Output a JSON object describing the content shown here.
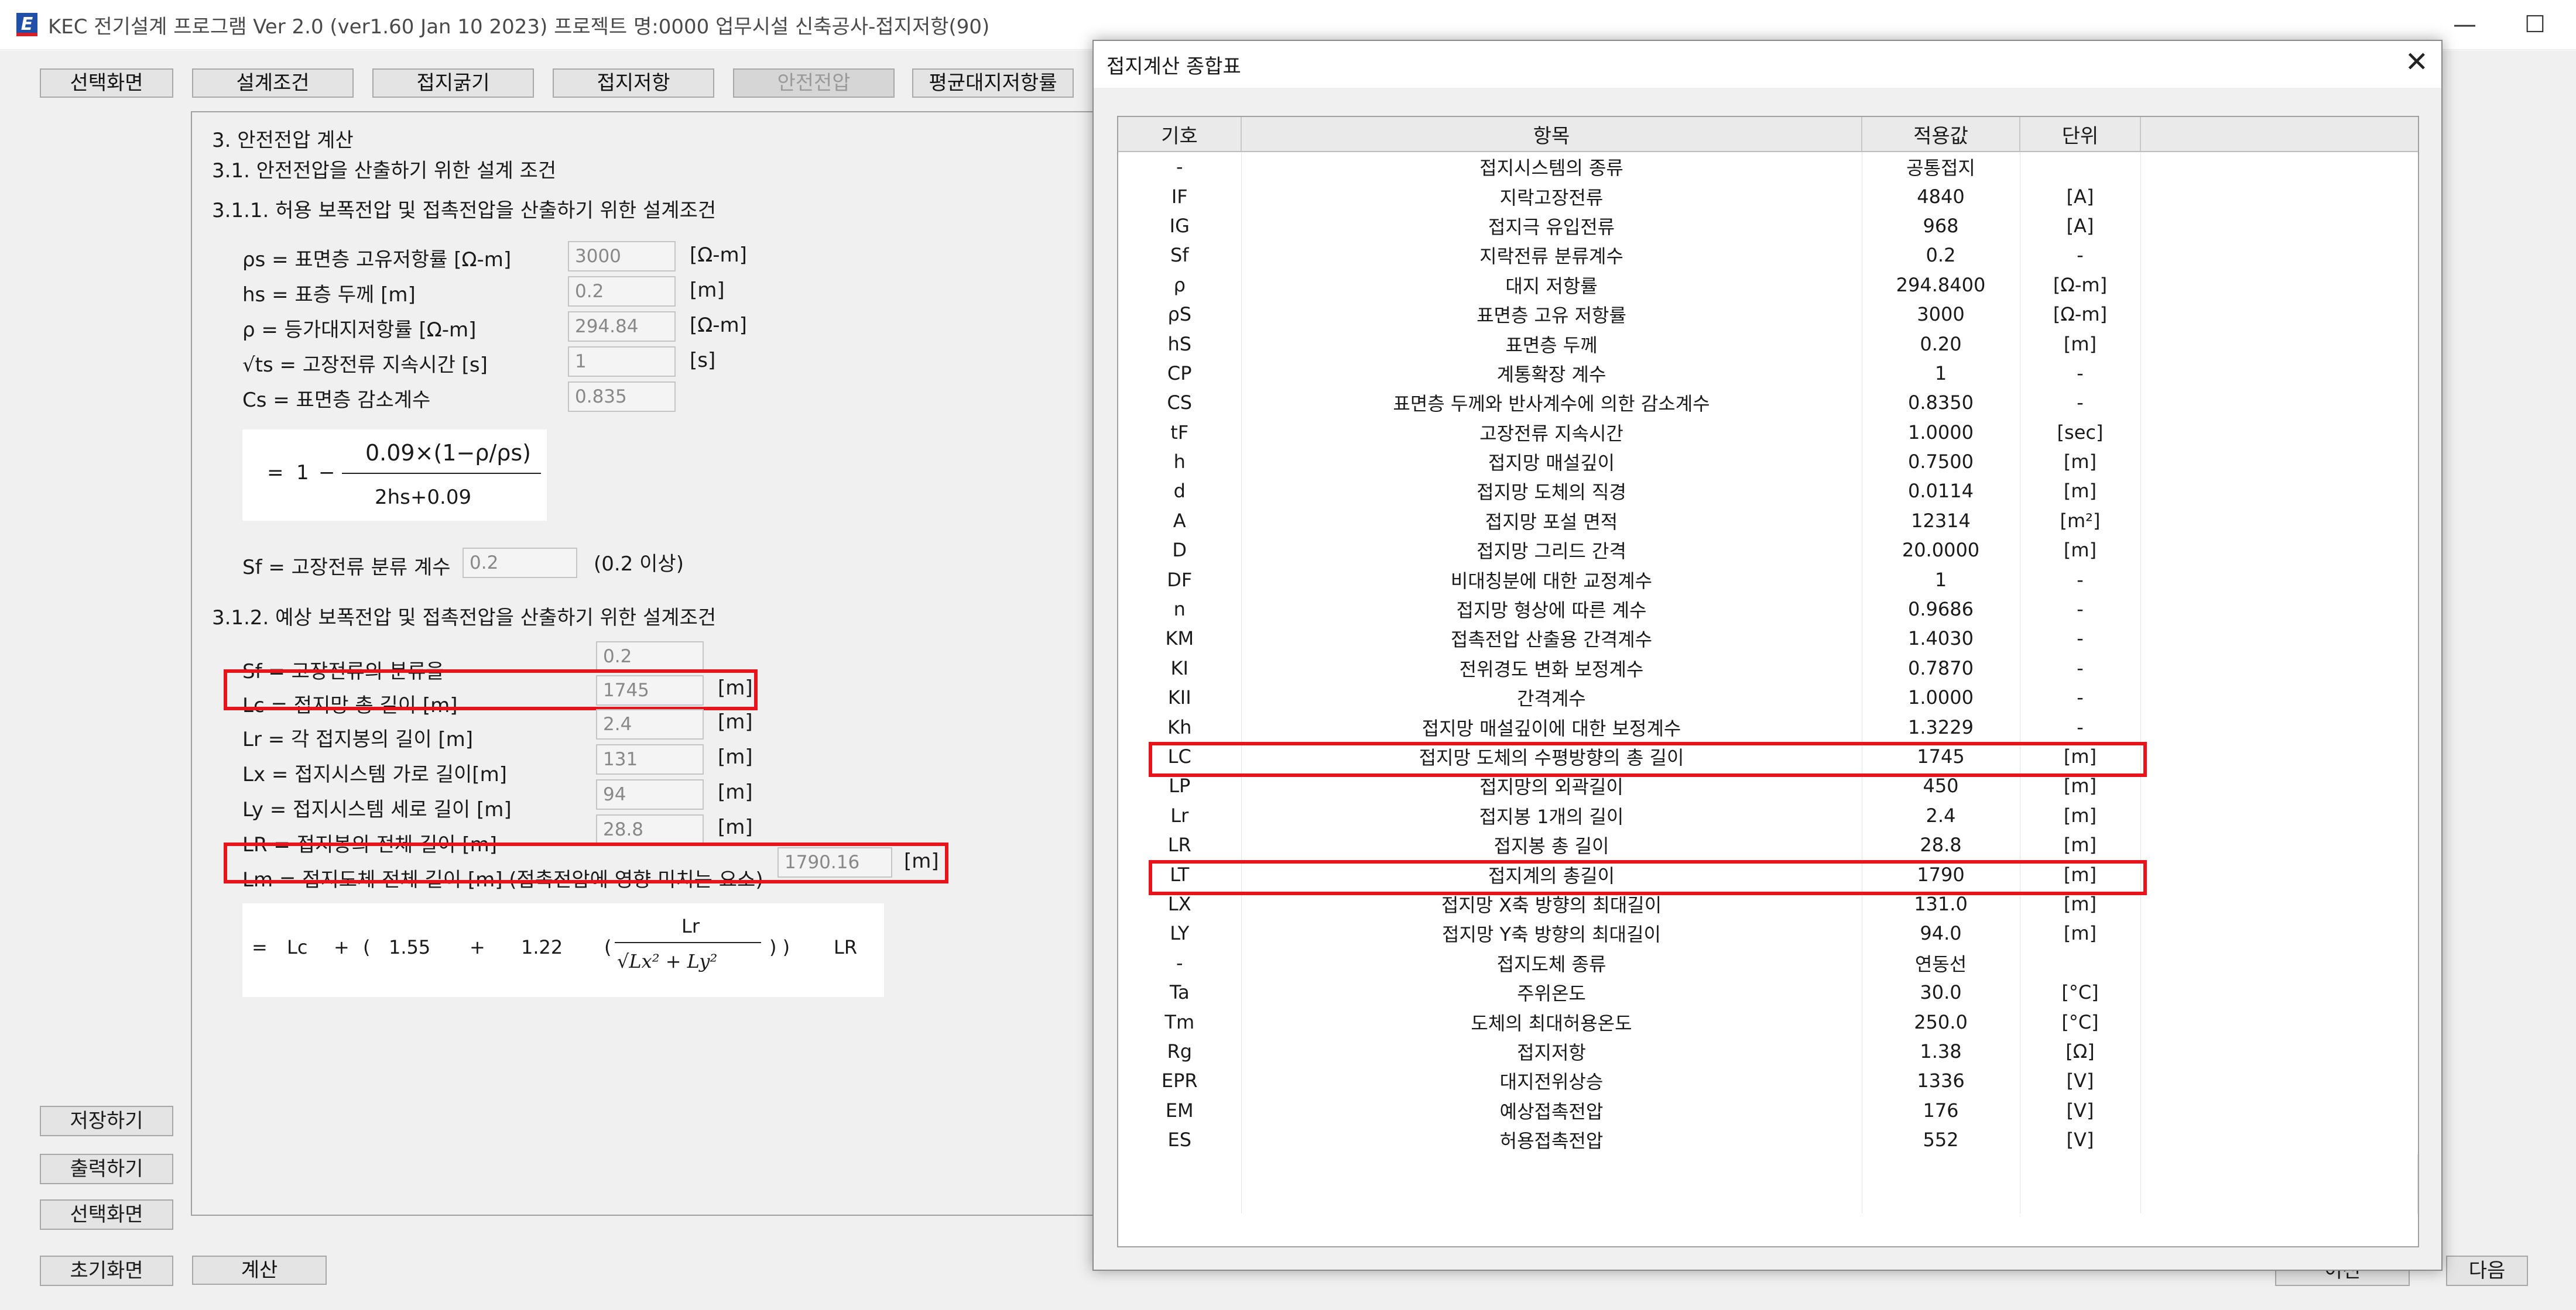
{
  "window": {
    "title": "KEC 전기설계 프로그램 Ver 2.0 (ver1.60 Jan 10 2023) 프로젝트 명:0000 업무시설 신축공사-접지저항(90)",
    "icon_letter": "E",
    "min_symbol": "—",
    "max_symbol": "☐"
  },
  "tabs": [
    "선택화면",
    "설계조건",
    "접지굵기",
    "접지저항",
    "안전전압",
    "평균대지저항률"
  ],
  "content": {
    "h1": "3. 안전전압 계산",
    "h2": "3.1. 안전전압을 산출하기 위한 설계 조건",
    "h3": "3.1.1. 허용 보폭전압 및 접촉전압을 산출하기 위한 설계조건",
    "params1": [
      {
        "label": "ρs = 표면층 고유저항률 [Ω-m]",
        "value": "3000",
        "unit": "[Ω-m]"
      },
      {
        "label": "hs = 표층 두께 [m]",
        "value": "0.2",
        "unit": "[m]"
      },
      {
        "label": "ρ = 등가대지저항률 [Ω-m]",
        "value": "294.84",
        "unit": "[Ω-m]"
      },
      {
        "label": "√ts = 고장전류 지속시간 [s]",
        "value": "1",
        "unit": "[s]"
      },
      {
        "label": "Cs = 표면층 감소계수",
        "value": "0.835",
        "unit": ""
      }
    ],
    "formula1": {
      "eq": "=",
      "one": "1",
      "minus": "−",
      "numerator": "0.09×(1−ρ/ρs)",
      "denominator": "2hs+0.09"
    },
    "sf_label": "Sf = 고장전류 분류 계수",
    "sf_value": "0.2",
    "sf_note": "(0.2 이상)",
    "h4": "3.1.2. 예상 보폭전압 및 접촉전압을 산출하기 위한 설계조건",
    "params2": [
      {
        "label": "Sf = 고장전류의 분류율",
        "value": "0.2",
        "unit": ""
      },
      {
        "label": "Lc = 접지망 총 길이 [m]",
        "value": "1745",
        "unit": "[m]"
      },
      {
        "label": "Lr = 각 접지봉의 길이 [m]",
        "value": "2.4",
        "unit": "[m]"
      },
      {
        "label": "Lx = 접지시스템 가로 길이[m]",
        "value": "131",
        "unit": "[m]"
      },
      {
        "label": "Ly = 접지시스템 세로 길이 [m]",
        "value": "94",
        "unit": "[m]"
      },
      {
        "label": "LR = 접지봉의 전체 길이 [m]",
        "value": "28.8",
        "unit": "[m]"
      }
    ],
    "lm_label": "Lm = 접지도체 전체 길이 [m] (접촉전압에 영향 미치는 요소)",
    "lm_value": "1790.16",
    "lm_unit": "[m]",
    "formula2": {
      "eq": "=",
      "lc": "Lc",
      "plus": "+",
      "lparen": "(",
      "a": "1.55",
      "plus2": "+",
      "b": "1.22",
      "lparen2": "(",
      "num": "Lr",
      "den": "√Lx² + Ly²",
      "rparen": ") )",
      "lr": "LR"
    }
  },
  "side_buttons": [
    "저장하기",
    "출력하기",
    "선택화면"
  ],
  "bottom_buttons": {
    "reset": "초기화면",
    "calc": "계산",
    "prev": "이전",
    "next": "다음"
  },
  "dialog": {
    "title": "접지계산 종합표",
    "close": "✕",
    "headers": [
      "기호",
      "항목",
      "적용값",
      "단위"
    ],
    "rows": [
      [
        "-",
        "접지시스템의 종류",
        "공통접지",
        ""
      ],
      [
        "IF",
        "지락고장전류",
        "4840",
        "[A]"
      ],
      [
        "IG",
        "접지극 유입전류",
        "968",
        "[A]"
      ],
      [
        "Sf",
        "지락전류 분류계수",
        "0.2",
        "-"
      ],
      [
        "ρ",
        "대지 저항률",
        "294.8400",
        "[Ω-m]"
      ],
      [
        "ρS",
        "표면층 고유 저항률",
        "3000",
        "[Ω-m]"
      ],
      [
        "hS",
        "표면층 두께",
        "0.20",
        "[m]"
      ],
      [
        "CP",
        "계통확장 계수",
        "1",
        "-"
      ],
      [
        "CS",
        "표면층 두께와 반사계수에 의한 감소계수",
        "0.8350",
        "-"
      ],
      [
        "tF",
        "고장전류 지속시간",
        "1.0000",
        "[sec]"
      ],
      [
        "h",
        "접지망 매설깊이",
        "0.7500",
        "[m]"
      ],
      [
        "d",
        "접지망 도체의 직경",
        "0.0114",
        "[m]"
      ],
      [
        "A",
        "접지망 포설 면적",
        "12314",
        "[m²]"
      ],
      [
        "D",
        "접지망 그리드 간격",
        "20.0000",
        "[m]"
      ],
      [
        "DF",
        "비대칭분에 대한 교정계수",
        "1",
        "-"
      ],
      [
        "n",
        "접지망 형상에 따른 계수",
        "0.9686",
        "-"
      ],
      [
        "KM",
        "접촉전압 산출용 간격계수",
        "1.4030",
        "-"
      ],
      [
        "KI",
        "전위경도 변화 보정계수",
        "0.7870",
        "-"
      ],
      [
        "KII",
        "간격계수",
        "1.0000",
        "-"
      ],
      [
        "Kh",
        "접지망 매설깊이에 대한 보정계수",
        "1.3229",
        "-"
      ],
      [
        "LC",
        "접지망 도체의 수평방향의 총 길이",
        "1745",
        "[m]"
      ],
      [
        "LP",
        "접지망의 외곽길이",
        "450",
        "[m]"
      ],
      [
        "Lr",
        "접지봉 1개의 길이",
        "2.4",
        "[m]"
      ],
      [
        "LR",
        "접지봉 총 길이",
        "28.8",
        "[m]"
      ],
      [
        "LT",
        "접지계의 총길이",
        "1790",
        "[m]"
      ],
      [
        "LX",
        "접지망 X축 방향의 최대길이",
        "131.0",
        "[m]"
      ],
      [
        "LY",
        "접지망 Y축 방향의 최대길이",
        "94.0",
        "[m]"
      ],
      [
        "-",
        "접지도체 종류",
        "연동선",
        ""
      ],
      [
        "Ta",
        "주위온도",
        "30.0",
        "[°C]"
      ],
      [
        "Tm",
        "도체의 최대허용온도",
        "250.0",
        "[°C]"
      ],
      [
        "Rg",
        "접지저항",
        "1.38",
        "[Ω]"
      ],
      [
        "EPR",
        "대지전위상승",
        "1336",
        "[V]"
      ],
      [
        "EM",
        "예상접촉전압",
        "176",
        "[V]"
      ],
      [
        "ES",
        "허용접촉전압",
        "552",
        "[V]"
      ]
    ]
  },
  "colors": {
    "highlight": "#e8141b",
    "brand_blue": "#1f4fa8"
  }
}
